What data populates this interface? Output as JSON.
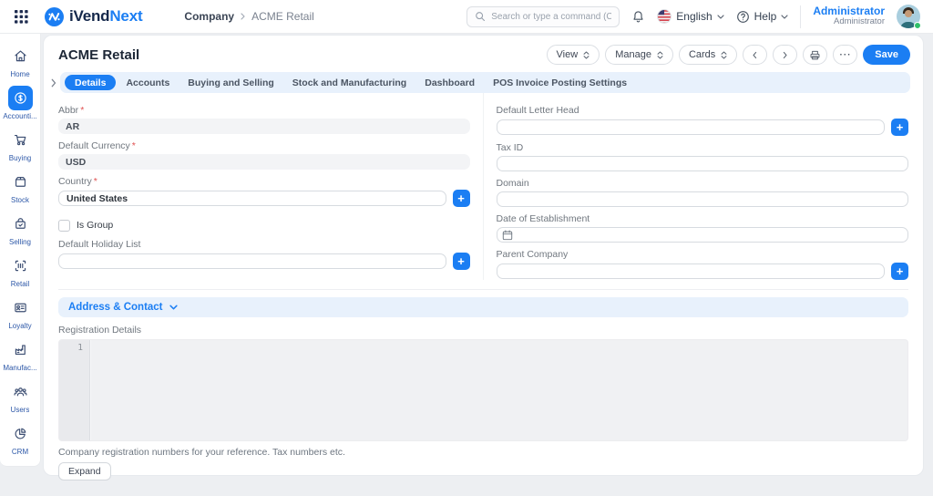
{
  "ui": {
    "required_marker": "*",
    "plus": "+",
    "ellipsis": "⋯"
  },
  "colors": {
    "accent": "#1b7ef3",
    "brand_dark": "#15284b",
    "tab_bg": "#e8f1fc",
    "page_bg": "#edeff2",
    "status_online": "#2fc06a"
  },
  "header": {
    "brand": {
      "primary": "iVend",
      "accent": "Next"
    },
    "breadcrumb": {
      "parent": "Company",
      "current": "ACME Retail"
    },
    "search_placeholder": "Search or type a command (Ctrl + G)",
    "language": "English",
    "help": "Help",
    "user": {
      "name": "Administrator",
      "role": "Administrator"
    }
  },
  "sidebar": {
    "items": [
      {
        "label": "Home",
        "icon": "home-icon",
        "active": false
      },
      {
        "label": "Accounti...",
        "icon": "accounting-icon",
        "active": true
      },
      {
        "label": "Buying",
        "icon": "buying-cart-icon",
        "active": false
      },
      {
        "label": "Stock",
        "icon": "stock-box-icon",
        "active": false
      },
      {
        "label": "Selling",
        "icon": "selling-bag-icon",
        "active": false
      },
      {
        "label": "Retail",
        "icon": "retail-barcode-icon",
        "active": false
      },
      {
        "label": "Loyalty",
        "icon": "loyalty-card-icon",
        "active": false
      },
      {
        "label": "Manufac...",
        "icon": "manufacturing-factory-icon",
        "active": false
      },
      {
        "label": "Users",
        "icon": "users-icon",
        "active": false
      },
      {
        "label": "CRM",
        "icon": "crm-pie-icon",
        "active": false
      }
    ]
  },
  "page": {
    "title": "ACME Retail",
    "toolbar": {
      "view": "View",
      "manage": "Manage",
      "cards": "Cards",
      "save": "Save"
    },
    "tabs": [
      {
        "label": "Details",
        "active": true
      },
      {
        "label": "Accounts",
        "active": false
      },
      {
        "label": "Buying and Selling",
        "active": false
      },
      {
        "label": "Stock and Manufacturing",
        "active": false
      },
      {
        "label": "Dashboard",
        "active": false
      },
      {
        "label": "POS Invoice Posting Settings",
        "active": false
      }
    ],
    "form": {
      "abbr": {
        "label": "Abbr",
        "value": "AR",
        "required": true
      },
      "default_currency": {
        "label": "Default Currency",
        "value": "USD",
        "required": true
      },
      "country": {
        "label": "Country",
        "value": "United States",
        "required": true
      },
      "is_group": {
        "label": "Is Group",
        "checked": false
      },
      "default_holiday_list": {
        "label": "Default Holiday List",
        "value": ""
      },
      "default_letter_head": {
        "label": "Default Letter Head",
        "value": ""
      },
      "tax_id": {
        "label": "Tax ID",
        "value": ""
      },
      "domain": {
        "label": "Domain",
        "value": ""
      },
      "date_of_establishment": {
        "label": "Date of Establishment",
        "value": ""
      },
      "parent_company": {
        "label": "Parent Company",
        "value": ""
      }
    },
    "sections": {
      "address_contact": "Address & Contact"
    },
    "registration": {
      "label": "Registration Details",
      "line_number": "1",
      "help": "Company registration numbers for your reference. Tax numbers etc.",
      "expand": "Expand"
    }
  }
}
